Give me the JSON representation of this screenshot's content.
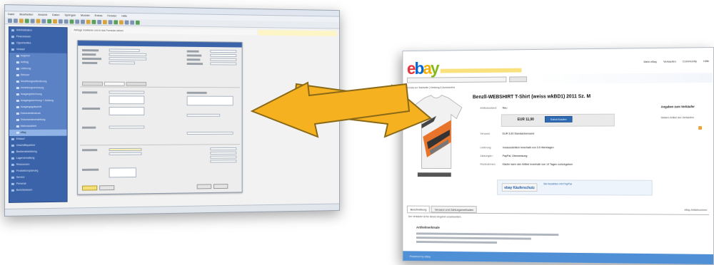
{
  "left_window": {
    "menu": [
      "Datei",
      "Bearbeiten",
      "Ansicht",
      "Daten",
      "Springen",
      "Module",
      "Extras",
      "Fenster",
      "Hilfe"
    ],
    "notice": "Abfrage markieren und in das Formular ziehen",
    "sidebar_items": [
      {
        "label": "Administration",
        "sub": false
      },
      {
        "label": "Finanzwesen",
        "sub": false
      },
      {
        "label": "Opportunities",
        "sub": false
      },
      {
        "label": "Verkauf",
        "sub": false
      },
      {
        "label": "Angebot",
        "sub": true
      },
      {
        "label": "Auftrag",
        "sub": true
      },
      {
        "label": "Lieferung",
        "sub": true
      },
      {
        "label": "Retoure",
        "sub": true
      },
      {
        "label": "Anzahlungsanforderung",
        "sub": true
      },
      {
        "label": "Anzahlungsrechnung",
        "sub": true
      },
      {
        "label": "Ausgangsrechnung",
        "sub": true
      },
      {
        "label": "Ausgangsrechnung + Zahlung",
        "sub": true
      },
      {
        "label": "Ausgangsgutschrift",
        "sub": true
      },
      {
        "label": "Dokumentendruck",
        "sub": true
      },
      {
        "label": "Dokumentenerstellung",
        "sub": true
      },
      {
        "label": "Mahnassistent",
        "sub": true
      },
      {
        "label": "eBay",
        "sub": true
      },
      {
        "label": "Einkauf",
        "sub": false
      },
      {
        "label": "Geschäftspartner",
        "sub": false
      },
      {
        "label": "Bankenabwicklung",
        "sub": false
      },
      {
        "label": "Lagerverwaltung",
        "sub": false
      },
      {
        "label": "Ressourcen",
        "sub": false
      },
      {
        "label": "Produktionsplanung",
        "sub": false
      },
      {
        "label": "Service",
        "sub": false
      },
      {
        "label": "Personal",
        "sub": false
      },
      {
        "label": "Berichtswesen",
        "sub": false
      }
    ]
  },
  "right_window": {
    "logo": {
      "e": "e",
      "b": "b",
      "a": "a",
      "y": "y"
    },
    "top_links": [
      "Mein eBay",
      "Verkaufen",
      "Community",
      "Hilfe"
    ],
    "breadcrumb": "Zurück zur Startseite | Kleidung & Accessoires",
    "item_title": "Benzll-WEBSHIRT T-Shirt (weiss wkBD1) 2011 Sz. M",
    "condition_label": "Artikelzustand:",
    "condition_value": "Neu",
    "price": "EUR 11,90",
    "buy_button": "Sofort-Kaufen",
    "info_rows": [
      {
        "label": "Versand:",
        "value": "EUR 5,90 Standardversand"
      },
      {
        "label": "Lieferung:",
        "value": "Voraussichtlich innerhalb von 3-5 Werktagen"
      },
      {
        "label": "Zahlungen:",
        "value": "PayPal, Überweisung"
      },
      {
        "label": "Rücknahmen:",
        "value": "Käufer kann den Artikel innerhalb von 14 Tagen zurückgeben"
      }
    ],
    "paypal_logo": "ebay Käuferschutz",
    "paypal_text": "Sie bezahlen mit PayPal",
    "side_title": "Angaben zum Verkäufer",
    "side_text": "Weitere Artikel des Verkäufers",
    "tabs": [
      "Beschreibung",
      "Versand und Zahlungsmethoden"
    ],
    "tab_note": "Der Verkäufer ist für dieses Angebot verantwortlich.",
    "tab_right": "eBay-Artikelnummer:",
    "section_head": "Artikelmerkmale",
    "footer_text": "Powered by eBay"
  },
  "colors": {
    "arrow": "#f5b120",
    "sidebar": "#3b63a9",
    "ebay_blue": "#0064d2"
  }
}
